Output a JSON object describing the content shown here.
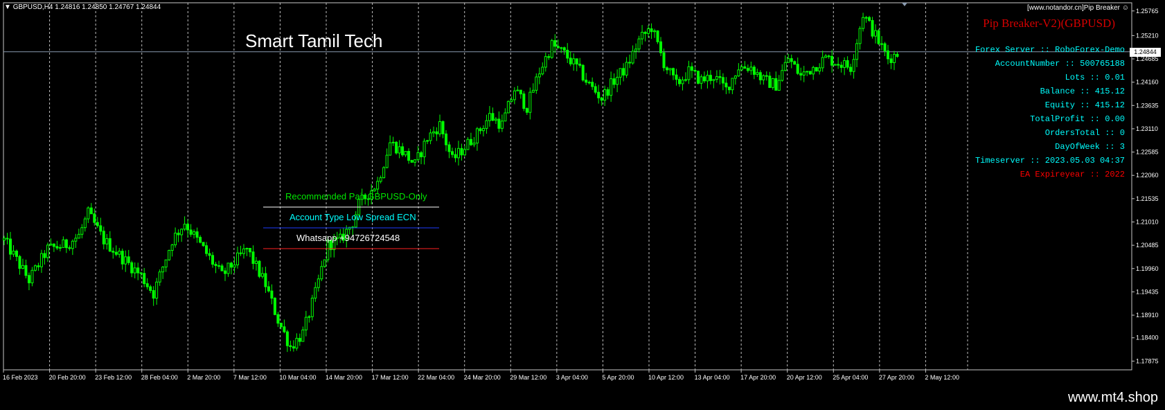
{
  "symbol_line": "GBPUSD,H4  1.24816 1.24850 1.24767 1.24844",
  "brand_title": "Smart Tamil Tech",
  "topright_label": "[www.notandor.cn]Pip Breaker",
  "ea_title": "Pip Breaker-V2)(GBPUSD)",
  "info_lines": [
    {
      "text": "Forex Server :: RoboForex-Demo",
      "color": "#00ffff"
    },
    {
      "text": "AccountNumber :: 500765188",
      "color": "#00ffff"
    },
    {
      "text": "Lots :: 0.01",
      "color": "#00ffff"
    },
    {
      "text": "Balance :: 415.12",
      "color": "#00ffff"
    },
    {
      "text": "Equity :: 415.12",
      "color": "#00ffff"
    },
    {
      "text": "TotalProfit :: 0.00",
      "color": "#00ffff"
    },
    {
      "text": "OrdersTotal :: 0",
      "color": "#00ffff"
    },
    {
      "text": "DayOfWeek :: 3",
      "color": "#00ffff"
    },
    {
      "text": "Timeserver :: 2023.05.03 04:37",
      "color": "#00ffff"
    },
    {
      "text": "EA Expireyear :: 2022",
      "color": "#ff0000"
    }
  ],
  "panel": {
    "recommended": "Recommended Pair GBPUSD-Only",
    "account_type": "Account Type Low Spread ECN",
    "whatsapp": "Whatsapp +94726724548",
    "colors": {
      "recommended": "#00e600",
      "account_type": "#00ffff",
      "whatsapp": "#ffffff"
    }
  },
  "chart_data": {
    "type": "candlestick",
    "ylim": [
      1.17678,
      1.25949
    ],
    "y_ticks": [
      "1.25765",
      "1.25210",
      "1.24685",
      "1.24160",
      "1.23635",
      "1.23110",
      "1.22585",
      "1.22060",
      "1.21535",
      "1.21010",
      "1.20485",
      "1.19960",
      "1.19435",
      "1.18910",
      "1.18400",
      "1.17875"
    ],
    "x_ticks": [
      "16 Feb 2023",
      "20 Feb 20:00",
      "23 Feb 12:00",
      "28 Feb 04:00",
      "2 Mar 20:00",
      "7 Mar 12:00",
      "10 Mar 04:00",
      "14 Mar 20:00",
      "17 Mar 12:00",
      "22 Mar 04:00",
      "24 Mar 20:00",
      "29 Mar 12:00",
      "3 Apr 04:00",
      "5 Apr 20:00",
      "10 Apr 12:00",
      "13 Apr 04:00",
      "17 Apr 20:00",
      "20 Apr 12:00",
      "25 Apr 04:00",
      "27 Apr 20:00",
      "2 May 12:00"
    ],
    "current_price": "1.24844",
    "current_price_value": 1.24844,
    "series_color": "#00ff00",
    "close_path": [
      [
        0,
        1.206
      ],
      [
        8,
        1.197
      ],
      [
        14,
        1.204
      ],
      [
        20,
        1.205
      ],
      [
        24,
        1.207
      ],
      [
        27,
        1.212
      ],
      [
        32,
        1.206
      ],
      [
        38,
        1.202
      ],
      [
        44,
        1.198
      ],
      [
        48,
        1.194
      ],
      [
        54,
        1.206
      ],
      [
        58,
        1.21
      ],
      [
        62,
        1.206
      ],
      [
        66,
        1.202
      ],
      [
        70,
        1.198
      ],
      [
        74,
        1.201
      ],
      [
        78,
        1.204
      ],
      [
        84,
        1.196
      ],
      [
        88,
        1.188
      ],
      [
        92,
        1.182
      ],
      [
        96,
        1.185
      ],
      [
        100,
        1.194
      ],
      [
        104,
        1.205
      ],
      [
        108,
        1.206
      ],
      [
        112,
        1.21
      ],
      [
        114,
        1.214
      ],
      [
        120,
        1.219
      ],
      [
        124,
        1.228
      ],
      [
        128,
        1.226
      ],
      [
        132,
        1.223
      ],
      [
        136,
        1.229
      ],
      [
        140,
        1.232
      ],
      [
        144,
        1.224
      ],
      [
        148,
        1.227
      ],
      [
        152,
        1.23
      ],
      [
        156,
        1.234
      ],
      [
        160,
        1.232
      ],
      [
        164,
        1.24
      ],
      [
        168,
        1.236
      ],
      [
        172,
        1.244
      ],
      [
        176,
        1.25
      ],
      [
        180,
        1.248
      ],
      [
        184,
        1.245
      ],
      [
        188,
        1.241
      ],
      [
        192,
        1.238
      ],
      [
        196,
        1.242
      ],
      [
        200,
        1.245
      ],
      [
        204,
        1.251
      ],
      [
        208,
        1.254
      ],
      [
        212,
        1.246
      ],
      [
        216,
        1.241
      ],
      [
        220,
        1.244
      ],
      [
        224,
        1.242
      ],
      [
        228,
        1.243
      ],
      [
        232,
        1.24
      ],
      [
        236,
        1.245
      ],
      [
        240,
        1.245
      ],
      [
        244,
        1.242
      ],
      [
        248,
        1.241
      ],
      [
        252,
        1.247
      ],
      [
        256,
        1.243
      ],
      [
        260,
        1.245
      ],
      [
        264,
        1.247
      ],
      [
        268,
        1.246
      ],
      [
        272,
        1.245
      ],
      [
        276,
        1.257
      ],
      [
        280,
        1.252
      ],
      [
        284,
        1.247
      ],
      [
        287,
        1.248
      ]
    ]
  }
}
